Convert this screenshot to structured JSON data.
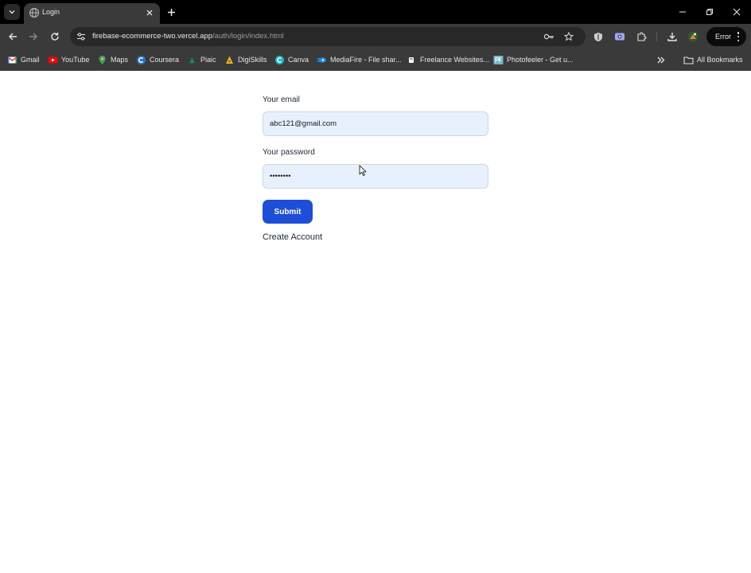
{
  "browser": {
    "tab": {
      "title": "Login"
    },
    "address_bar": {
      "url_host": "firebase-ecommerce-two.vercel.app",
      "url_path": "/auth/login/index.html"
    },
    "profile_status": "Error",
    "bookmarks": [
      {
        "label": "Gmail",
        "icon": "gmail-icon"
      },
      {
        "label": "YouTube",
        "icon": "youtube-icon"
      },
      {
        "label": "Maps",
        "icon": "maps-icon"
      },
      {
        "label": "Coursera",
        "icon": "coursera-icon"
      },
      {
        "label": "Piaic",
        "icon": "piaic-icon"
      },
      {
        "label": "DigiSkills",
        "icon": "digiskills-icon"
      },
      {
        "label": "Canva",
        "icon": "canva-icon"
      },
      {
        "label": "MediaFire - File shar...",
        "icon": "mediafire-icon"
      },
      {
        "label": "Freelance Websites...",
        "icon": "freelance-icon"
      },
      {
        "label": "Photofeeler - Get u...",
        "icon": "photofeeler-icon"
      }
    ],
    "all_bookmarks_label": "All Bookmarks"
  },
  "login_form": {
    "email_label": "Your email",
    "email_value": "abc121@gmail.com",
    "password_label": "Your password",
    "password_value": "••••••••",
    "submit_label": "Submit",
    "create_account_label": "Create Account"
  },
  "colors": {
    "chrome_dark": "#000000",
    "chrome_toolbar": "#3a3a3a",
    "input_fill": "#e8f0fe",
    "submit_button": "#1d4ed8"
  }
}
